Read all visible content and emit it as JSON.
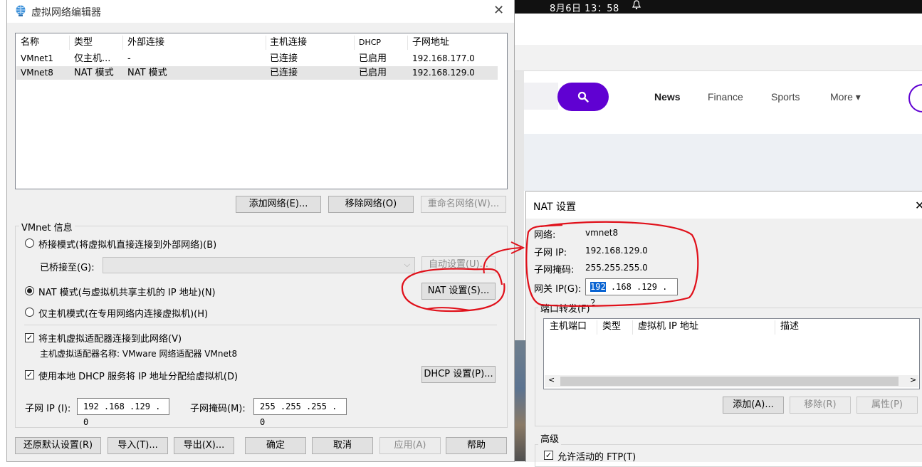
{
  "taskbar": {
    "clock": "8月6日  13：58",
    "bell_icon": "bell-icon"
  },
  "browser": {
    "nav": [
      "News",
      "Finance",
      "Sports",
      "More ▾"
    ],
    "accent": "#6001d2"
  },
  "main_dialog": {
    "title": "虚拟网络编辑器",
    "columns": [
      "名称",
      "类型",
      "外部连接",
      "主机连接",
      "DHCP",
      "子网地址"
    ],
    "rows": [
      [
        "VMnet1",
        "仅主机...",
        "-",
        "已连接",
        "已启用",
        "192.168.177.0"
      ],
      [
        "VMnet8",
        "NAT 模式",
        "NAT 模式",
        "已连接",
        "已启用",
        "192.168.129.0"
      ]
    ],
    "add_network": "添加网络(E)...",
    "remove_network": "移除网络(O)",
    "rename_network": "重命名网络(W)...",
    "vmnet_info": "VMnet 信息",
    "bridge_mode": "桥接模式(将虚拟机直接连接到外部网络)(B)",
    "bridged_to": "已桥接至(G):",
    "auto_settings": "自动设置(U)...",
    "nat_mode": "NAT 模式(与虚拟机共享主机的 IP 地址)(N)",
    "nat_settings": "NAT 设置(S)...",
    "host_only_mode": "仅主机模式(在专用网络内连接虚拟机)(H)",
    "connect_adapter": "将主机虚拟适配器连接到此网络(V)",
    "adapter_name": "主机虚拟适配器名称: VMware 网络适配器 VMnet8",
    "use_dhcp": "使用本地 DHCP 服务将 IP 地址分配给虚拟机(D)",
    "dhcp_settings": "DHCP 设置(P)...",
    "subnet_ip_label": "子网 IP (I):",
    "subnet_ip": "192 .168 .129 .  0",
    "subnet_mask_label": "子网掩码(M):",
    "subnet_mask": "255 .255 .255 .  0",
    "restore_defaults": "还原默认设置(R)",
    "import": "导入(T)...",
    "export": "导出(X)...",
    "ok": "确定",
    "cancel": "取消",
    "apply": "应用(A)",
    "help": "帮助"
  },
  "nat_dialog": {
    "title": "NAT 设置",
    "network_label": "网络:",
    "network_value": "vmnet8",
    "subnet_ip_label": "子网 IP:",
    "subnet_ip_value": "192.168.129.0",
    "subnet_mask_label": "子网掩码:",
    "subnet_mask_value": "255.255.255.0",
    "gateway_label": "网关 IP(G):",
    "gateway_sel": "192",
    "gateway_rest": " .168 .129 .  2",
    "port_forwarding": "端口转发(F)",
    "pf_columns": [
      "主机端口",
      "类型",
      "虚拟机 IP 地址",
      "描述"
    ],
    "add": "添加(A)...",
    "remove": "移除(R)",
    "properties": "属性(P)",
    "advanced": "高级",
    "allow_ftp": "允许活动的 FTP(T)"
  }
}
